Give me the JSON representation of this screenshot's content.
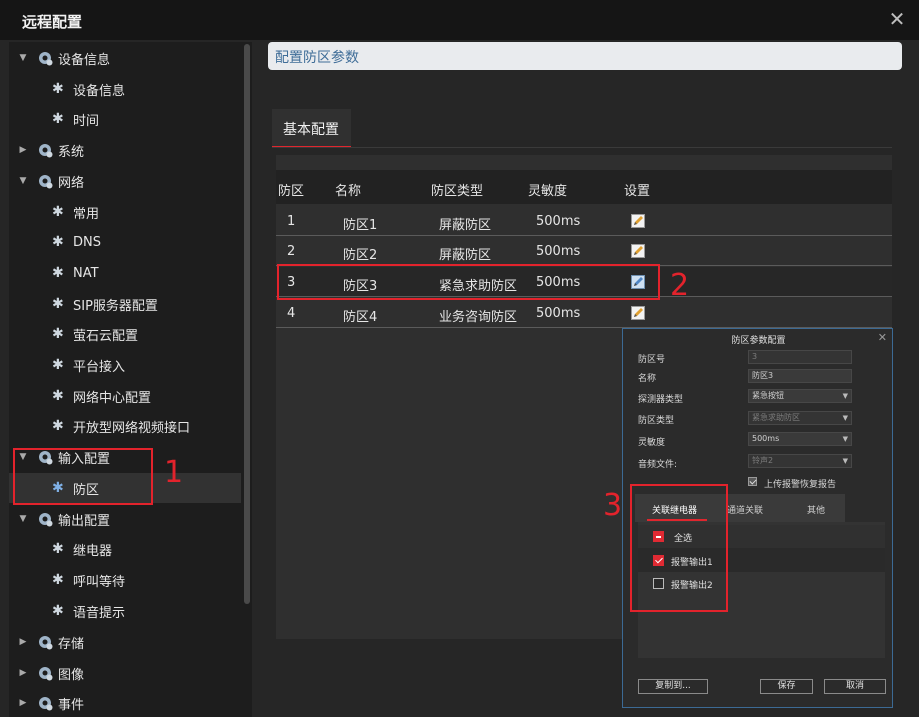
{
  "window": {
    "title": "远程配置"
  },
  "sidebar": {
    "items": [
      {
        "label": "设备信息"
      },
      {
        "label": "设备信息"
      },
      {
        "label": "时间"
      },
      {
        "label": "系统"
      },
      {
        "label": "网络"
      },
      {
        "label": "常用"
      },
      {
        "label": "DNS"
      },
      {
        "label": "NAT"
      },
      {
        "label": "SIP服务器配置"
      },
      {
        "label": "萤石云配置"
      },
      {
        "label": "平台接入"
      },
      {
        "label": "网络中心配置"
      },
      {
        "label": "开放型网络视频接口"
      },
      {
        "label": "输入配置"
      },
      {
        "label": "防区"
      },
      {
        "label": "输出配置"
      },
      {
        "label": "继电器"
      },
      {
        "label": "呼叫等待"
      },
      {
        "label": "语音提示"
      },
      {
        "label": "存储"
      },
      {
        "label": "图像"
      },
      {
        "label": "事件"
      }
    ]
  },
  "main": {
    "header": "配置防区参数",
    "tab": "基本配置",
    "columns": [
      "防区",
      "名称",
      "防区类型",
      "灵敏度",
      "设置"
    ],
    "rows": [
      {
        "id": "1",
        "name": "防区1",
        "type": "屏蔽防区",
        "sensitivity": "500ms"
      },
      {
        "id": "2",
        "name": "防区2",
        "type": "屏蔽防区",
        "sensitivity": "500ms"
      },
      {
        "id": "3",
        "name": "防区3",
        "type": "紧急求助防区",
        "sensitivity": "500ms"
      },
      {
        "id": "4",
        "name": "防区4",
        "type": "业务咨询防区",
        "sensitivity": "500ms"
      }
    ]
  },
  "annotations": {
    "n1": "1",
    "n2": "2",
    "n3": "3"
  },
  "dialog": {
    "title": "防区参数配置",
    "fields": [
      {
        "label": "防区号",
        "value": "3"
      },
      {
        "label": "名称",
        "value": "防区3"
      },
      {
        "label": "探测器类型",
        "value": "紧急按钮"
      },
      {
        "label": "防区类型",
        "value": "紧急求助防区"
      },
      {
        "label": "灵敏度",
        "value": "500ms"
      },
      {
        "label": "音频文件:",
        "value": "铃声2"
      }
    ],
    "upload_label": "上传报警恢复报告",
    "tabs": [
      "关联继电器",
      "通道关联",
      "其他"
    ],
    "relays": {
      "select_all": "全选",
      "items": [
        "报警输出1",
        "报警输出2"
      ]
    },
    "buttons": {
      "copy": "复制到...",
      "save": "保存",
      "cancel": "取消"
    }
  }
}
